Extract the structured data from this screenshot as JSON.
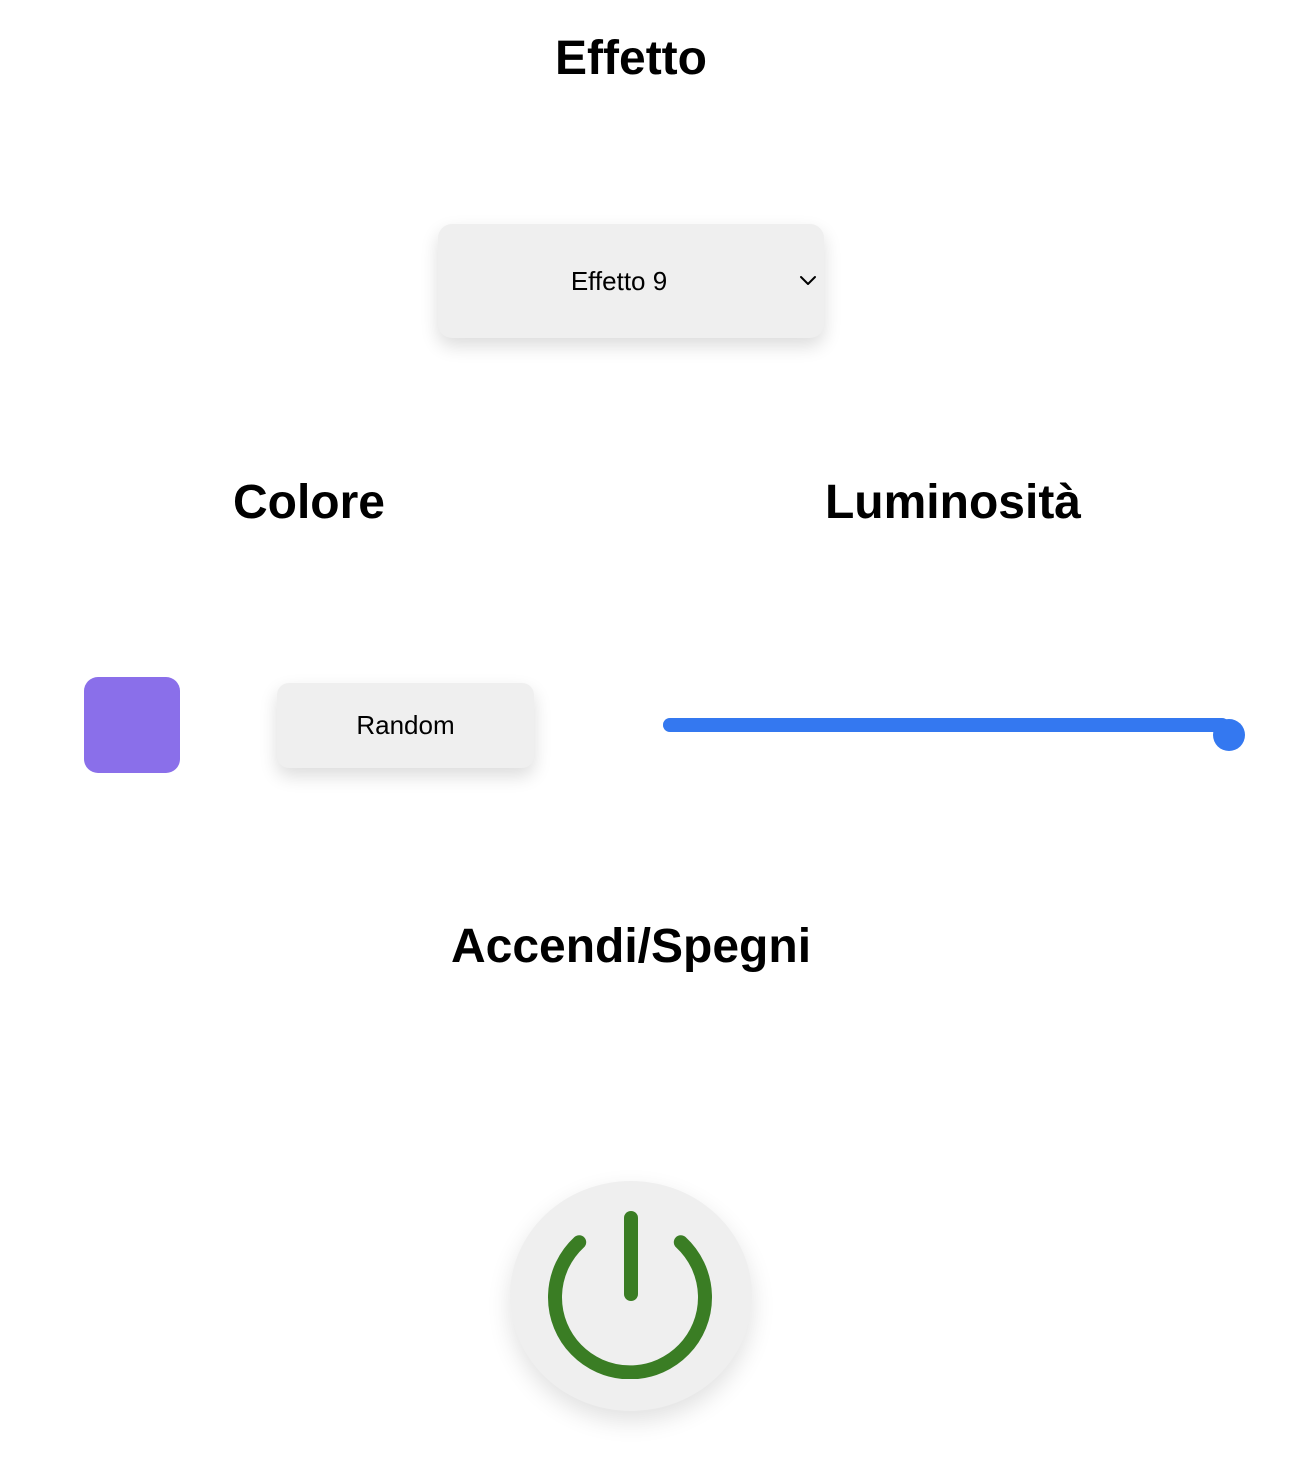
{
  "effect": {
    "heading": "Effetto",
    "selected": "Effetto 9",
    "chevron_icon": "chevron-down-icon"
  },
  "color": {
    "heading": "Colore",
    "swatch_color": "#8a6fea",
    "random_label": "Random"
  },
  "brightness": {
    "heading": "Luminosità",
    "value_fraction": 1.0,
    "accent_color": "#3478f0"
  },
  "power": {
    "heading": "Accendi/Spegni",
    "icon": "power-icon",
    "icon_color": "#3a7d24"
  }
}
